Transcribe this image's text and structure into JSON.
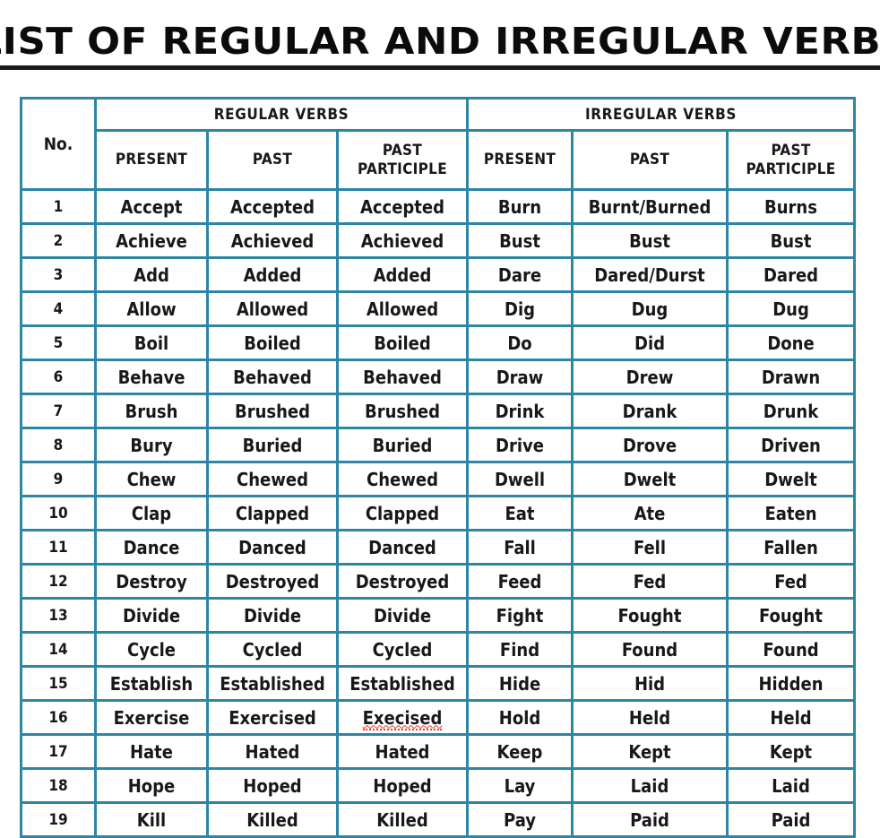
{
  "page": {
    "title": "LIST OF REGULAR AND IRREGULAR VERBS"
  },
  "colors": {
    "header_green": "#8fc95a",
    "border_teal": "#2d86a6",
    "text": "#17181a",
    "spellcheck_red": "#e23b2e",
    "background": "#ffffff"
  },
  "table": {
    "number_column_header": "No.",
    "groups": [
      {
        "label": "REGULAR VERBS",
        "span": 3
      },
      {
        "label": "IRREGULAR VERBS",
        "span": 3
      }
    ],
    "subheaders": [
      "PRESENT",
      "PAST",
      "PAST PARTICIPLE",
      "PRESENT",
      "PAST",
      "PAST PARTICIPLE"
    ],
    "rows": [
      {
        "no": "1",
        "regular_present": "Accept",
        "regular_past": "Accepted",
        "regular_past_participle": "Accepted",
        "irregular_present": "Burn",
        "irregular_past": "Burnt/Burned",
        "irregular_past_participle": "Burns"
      },
      {
        "no": "2",
        "regular_present": "Achieve",
        "regular_past": "Achieved",
        "regular_past_participle": "Achieved",
        "irregular_present": "Bust",
        "irregular_past": "Bust",
        "irregular_past_participle": "Bust"
      },
      {
        "no": "3",
        "regular_present": "Add",
        "regular_past": "Added",
        "regular_past_participle": "Added",
        "irregular_present": "Dare",
        "irregular_past": "Dared/Durst",
        "irregular_past_participle": "Dared"
      },
      {
        "no": "4",
        "regular_present": "Allow",
        "regular_past": "Allowed",
        "regular_past_participle": "Allowed",
        "irregular_present": "Dig",
        "irregular_past": "Dug",
        "irregular_past_participle": "Dug"
      },
      {
        "no": "5",
        "regular_present": "Boil",
        "regular_past": "Boiled",
        "regular_past_participle": "Boiled",
        "irregular_present": "Do",
        "irregular_past": "Did",
        "irregular_past_participle": "Done"
      },
      {
        "no": "6",
        "regular_present": "Behave",
        "regular_past": "Behaved",
        "regular_past_participle": "Behaved",
        "irregular_present": "Draw",
        "irregular_past": "Drew",
        "irregular_past_participle": "Drawn"
      },
      {
        "no": "7",
        "regular_present": "Brush",
        "regular_past": "Brushed",
        "regular_past_participle": "Brushed",
        "irregular_present": "Drink",
        "irregular_past": "Drank",
        "irregular_past_participle": "Drunk"
      },
      {
        "no": "8",
        "regular_present": "Bury",
        "regular_past": "Buried",
        "regular_past_participle": "Buried",
        "irregular_present": "Drive",
        "irregular_past": "Drove",
        "irregular_past_participle": "Driven"
      },
      {
        "no": "9",
        "regular_present": "Chew",
        "regular_past": "Chewed",
        "regular_past_participle": "Chewed",
        "irregular_present": "Dwell",
        "irregular_past": "Dwelt",
        "irregular_past_participle": "Dwelt"
      },
      {
        "no": "10",
        "regular_present": "Clap",
        "regular_past": "Clapped",
        "regular_past_participle": "Clapped",
        "irregular_present": "Eat",
        "irregular_past": "Ate",
        "irregular_past_participle": "Eaten"
      },
      {
        "no": "11",
        "regular_present": "Dance",
        "regular_past": "Danced",
        "regular_past_participle": "Danced",
        "irregular_present": "Fall",
        "irregular_past": "Fell",
        "irregular_past_participle": "Fallen"
      },
      {
        "no": "12",
        "regular_present": "Destroy",
        "regular_past": "Destroyed",
        "regular_past_participle": "Destroyed",
        "irregular_present": "Feed",
        "irregular_past": "Fed",
        "irregular_past_participle": "Fed"
      },
      {
        "no": "13",
        "regular_present": "Divide",
        "regular_past": "Divide",
        "regular_past_participle": "Divide",
        "irregular_present": "Fight",
        "irregular_past": "Fought",
        "irregular_past_participle": "Fought"
      },
      {
        "no": "14",
        "regular_present": "Cycle",
        "regular_past": "Cycled",
        "regular_past_participle": "Cycled",
        "irregular_present": "Find",
        "irregular_past": "Found",
        "irregular_past_participle": "Found"
      },
      {
        "no": "15",
        "regular_present": "Establish",
        "regular_past": "Established",
        "regular_past_participle": "Established",
        "irregular_present": "Hide",
        "irregular_past": "Hid",
        "irregular_past_participle": "Hidden"
      },
      {
        "no": "16",
        "regular_present": "Exercise",
        "regular_past": "Exercised",
        "regular_past_participle": "Execised",
        "regular_past_participle_misspelled": true,
        "irregular_present": "Hold",
        "irregular_past": "Held",
        "irregular_past_participle": "Held"
      },
      {
        "no": "17",
        "regular_present": "Hate",
        "regular_past": "Hated",
        "regular_past_participle": "Hated",
        "irregular_present": "Keep",
        "irregular_past": "Kept",
        "irregular_past_participle": "Kept"
      },
      {
        "no": "18",
        "regular_present": "Hope",
        "regular_past": "Hoped",
        "regular_past_participle": "Hoped",
        "irregular_present": "Lay",
        "irregular_past": "Laid",
        "irregular_past_participle": "Laid"
      },
      {
        "no": "19",
        "regular_present": "Kill",
        "regular_past": "Killed",
        "regular_past_participle": "Killed",
        "irregular_present": "Pay",
        "irregular_past": "Paid",
        "irregular_past_participle": "Paid"
      }
    ]
  }
}
